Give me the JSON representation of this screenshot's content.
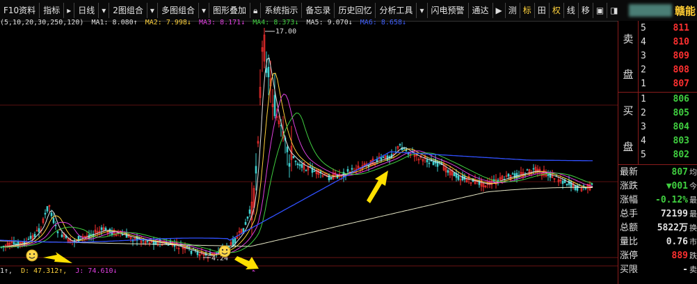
{
  "toolbar": {
    "items": [
      "F10资料",
      "指标",
      "日线",
      "2图组合",
      "多图组合",
      "图形叠加",
      "系统指示",
      "备忘录",
      "历史回忆",
      "分析工具",
      "闪电预警",
      "通达"
    ],
    "right_buttons": [
      "测",
      "标",
      "田",
      "权",
      "线",
      "移"
    ]
  },
  "stock": {
    "name": "赣能"
  },
  "ma": {
    "params": "(5,10,20,30,250,120)",
    "items": [
      {
        "label": "MA1: 8.080↑",
        "color": "#e0e0e0"
      },
      {
        "label": "MA2: 7.998↓",
        "color": "#ffd23c"
      },
      {
        "label": "MA3: 8.171↓",
        "color": "#e040e0"
      },
      {
        "label": "MA4: 8.373↓",
        "color": "#40d040"
      },
      {
        "label": "MA5: 9.070↓",
        "color": "#e0e0e0"
      },
      {
        "label": "MA6: 8.658↓",
        "color": "#4060ff"
      }
    ]
  },
  "annotations": {
    "high": "17.00",
    "low": "4.24"
  },
  "kdj": {
    "items": [
      {
        "label": "1↑,",
        "color": "#e0e0e0"
      },
      {
        "label": "D: 47.312↑,",
        "color": "#ffd23c"
      },
      {
        "label": "J: 74.610↓",
        "color": "#e040e0"
      }
    ]
  },
  "order_book": {
    "sell_title": [
      "卖",
      "盘"
    ],
    "buy_title": [
      "买",
      "盘"
    ],
    "sell": [
      {
        "level": "5",
        "price": "811"
      },
      {
        "level": "4",
        "price": "810"
      },
      {
        "level": "3",
        "price": "809"
      },
      {
        "level": "2",
        "price": "808"
      },
      {
        "level": "1",
        "price": "807"
      }
    ],
    "buy": [
      {
        "level": "1",
        "price": "806"
      },
      {
        "level": "2",
        "price": "805"
      },
      {
        "level": "3",
        "price": "804"
      },
      {
        "level": "4",
        "price": "803"
      },
      {
        "level": "5",
        "price": "802"
      }
    ]
  },
  "quote": [
    {
      "label": "最新",
      "value": "807",
      "color": "#40d040",
      "tail": "均"
    },
    {
      "label": "涨跌",
      "value": "▼001",
      "color": "#40d040",
      "tail": "今"
    },
    {
      "label": "涨幅",
      "value": "-0.12%",
      "color": "#40d040",
      "tail": "最"
    },
    {
      "label": "总手",
      "value": "72199",
      "color": "#e0e0e0",
      "tail": "最"
    },
    {
      "label": "总额",
      "value": "5822万",
      "color": "#e0e0e0",
      "tail": "换"
    },
    {
      "label": "量比",
      "value": "0.76",
      "color": "#e0e0e0",
      "tail": "市"
    },
    {
      "label": "涨停",
      "value": "889",
      "color": "#ff3030",
      "tail": "跌"
    },
    {
      "label": "买限",
      "value": "-",
      "color": "#e0e0e0",
      "tail": "卖"
    }
  ],
  "colors": {
    "up": "#ff3030",
    "down": "#40d0d0",
    "grid": "#5a1010",
    "arrow": "#ffe000"
  }
}
